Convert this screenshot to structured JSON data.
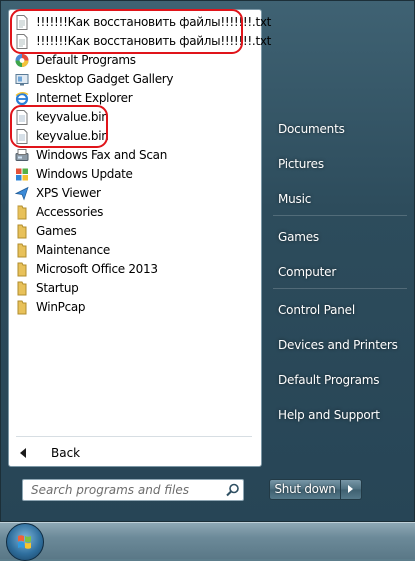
{
  "programs": [
    {
      "label": "!!!!!!!Как восстановить файлы!!!!!!!.txt",
      "icon": "text-file-icon"
    },
    {
      "label": "!!!!!!!Как восстановить файлы!!!!!!!.txt",
      "icon": "text-file-icon"
    },
    {
      "label": "Default Programs",
      "icon": "default-programs-icon"
    },
    {
      "label": "Desktop Gadget Gallery",
      "icon": "gadget-gallery-icon"
    },
    {
      "label": "Internet Explorer",
      "icon": "internet-explorer-icon"
    },
    {
      "label": "keyvalue.bin",
      "icon": "bin-file-icon"
    },
    {
      "label": "keyvalue.bin",
      "icon": "bin-file-icon"
    },
    {
      "label": "Windows Fax and Scan",
      "icon": "fax-scan-icon"
    },
    {
      "label": "Windows Update",
      "icon": "windows-update-icon"
    },
    {
      "label": "XPS Viewer",
      "icon": "xps-viewer-icon"
    },
    {
      "label": "Accessories",
      "icon": "folder-icon"
    },
    {
      "label": "Games",
      "icon": "folder-icon"
    },
    {
      "label": "Maintenance",
      "icon": "folder-icon"
    },
    {
      "label": "Microsoft Office 2013",
      "icon": "folder-icon"
    },
    {
      "label": "Startup",
      "icon": "folder-icon"
    },
    {
      "label": "WinPcap",
      "icon": "folder-icon"
    }
  ],
  "back_label": "Back",
  "search": {
    "placeholder": "Search programs and files"
  },
  "right_items": [
    "Documents",
    "Pictures",
    "Music",
    "Games",
    "Computer",
    "Control Panel",
    "Devices and Printers",
    "Default Programs",
    "Help and Support"
  ],
  "shutdown_label": "Shut down",
  "colors": {
    "highlight": "#e0141a",
    "pane_bg": "#ffffff",
    "frame": "#2d4c5c"
  }
}
